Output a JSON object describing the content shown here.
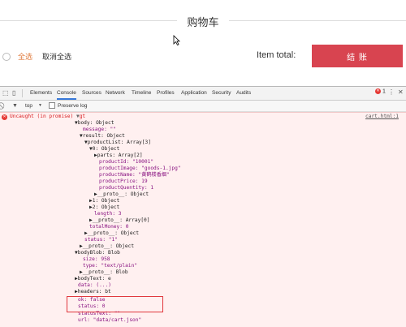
{
  "page": {
    "title": "购物车",
    "select_all": "全选",
    "cancel_all": "取消全选",
    "item_total_label": "Item total:",
    "pay_button": "结 账"
  },
  "devtools": {
    "tabs": [
      "Elements",
      "Console",
      "Sources",
      "Network",
      "Timeline",
      "Profiles",
      "Application",
      "Security",
      "Audits"
    ],
    "active_tab": "Console",
    "error_count": "1",
    "context": "top",
    "preserve_log": "Preserve log"
  },
  "console": {
    "error_prefix": "Uncaught (in promise)",
    "error_obj": "gt",
    "source_link": "cart.html:1",
    "lines": [
      "▼body: Object",
      "message: \"\"",
      "▼result: Object",
      "▼productList: Array[3]",
      "▼0: Object",
      "▶parts: Array[2]",
      "productId: \"10001\"",
      "productImage: \"goods-1.jpg\"",
      "productName: \"黄鹤楼香烟\"",
      "productPrice: 19",
      "productQuentity: 1",
      "▶__proto__: Object",
      "▶1: Object",
      "▶2: Object",
      "length: 3",
      "▶__proto__: Array[0]",
      "totalMoney: 0",
      "▶__proto__: Object",
      "status: \"1\"",
      "▶__proto__: Object",
      "▼bodyBlob: Blob",
      "size: 958",
      "type: \"text/plain\"",
      "▶__proto__: Blob",
      "▶bodyText: e",
      "data: (...)",
      "▶headers: bt",
      "ok: false",
      "status: 0",
      "statusText: \"\"",
      "url: \"data/cart.json\""
    ]
  }
}
